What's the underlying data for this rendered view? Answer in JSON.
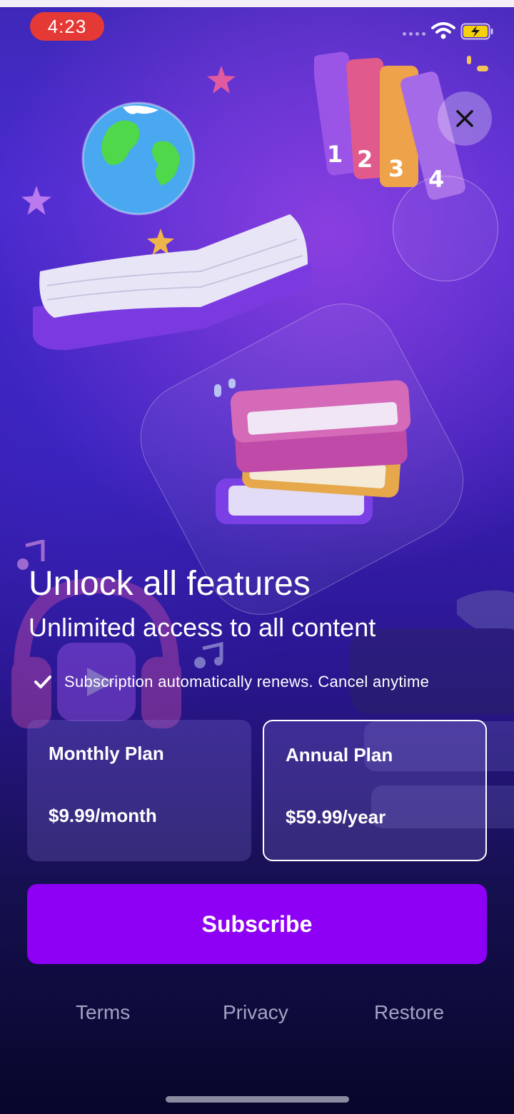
{
  "status_bar": {
    "time": "4:23",
    "battery_color": "#f5d10c"
  },
  "icons": {
    "close": "close-icon",
    "check": "check-icon",
    "wifi": "wifi-icon",
    "battery": "battery-charging-icon"
  },
  "hero": {
    "title": "Unlock all features",
    "subtitle": "Unlimited access to all content",
    "renewal_note": "Subscription automatically renews. Cancel anytime"
  },
  "plans": [
    {
      "name": "Monthly Plan",
      "price": "$9.99/month",
      "selected": false
    },
    {
      "name": "Annual Plan",
      "price": "$59.99/year",
      "selected": true
    }
  ],
  "actions": {
    "subscribe_label": "Subscribe"
  },
  "footer": {
    "terms": "Terms",
    "privacy": "Privacy",
    "restore": "Restore"
  },
  "colors": {
    "accent": "#8e00f5",
    "alert_pill": "#e53935",
    "footer_text": "#a4a2c4"
  }
}
